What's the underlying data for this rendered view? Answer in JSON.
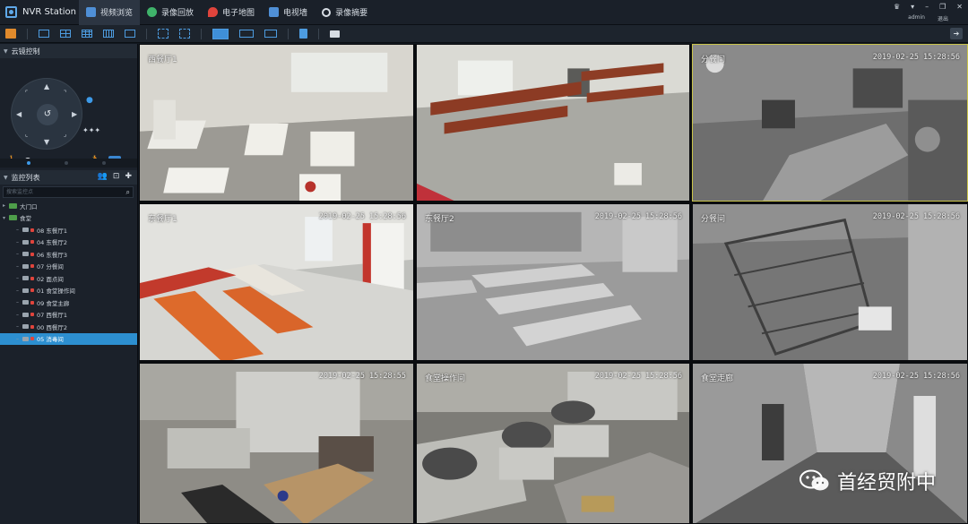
{
  "app": {
    "name": "NVR Station",
    "user": "admin",
    "logout": "退出"
  },
  "tabs": [
    {
      "label": "视频浏览",
      "active": true,
      "icon": "monitor-icon",
      "color": "#4f8fd6"
    },
    {
      "label": "录像回放",
      "active": false,
      "icon": "playback-icon",
      "color": "#3fb36a"
    },
    {
      "label": "电子地图",
      "active": false,
      "icon": "map-pin-icon",
      "color": "#e0443c"
    },
    {
      "label": "电视墙",
      "active": false,
      "icon": "tv-wall-icon",
      "color": "#4f8fd6"
    },
    {
      "label": "录像摘要",
      "active": false,
      "icon": "search-icon",
      "color": "#d8dee5"
    }
  ],
  "ptz": {
    "title": "云镜控制"
  },
  "device_tree": {
    "title": "监控列表",
    "search_placeholder": "搜索监控点",
    "nodes": [
      {
        "label": "大门口",
        "level": 0,
        "type": "group",
        "expanded": false
      },
      {
        "label": "食堂",
        "level": 0,
        "type": "group",
        "expanded": true
      },
      {
        "label": "08 东餐厅1",
        "level": 1,
        "type": "camera"
      },
      {
        "label": "04 东餐厅2",
        "level": 1,
        "type": "camera"
      },
      {
        "label": "06 东餐厅3",
        "level": 1,
        "type": "camera"
      },
      {
        "label": "07 分餐间",
        "level": 1,
        "type": "camera"
      },
      {
        "label": "02 面点间",
        "level": 1,
        "type": "camera"
      },
      {
        "label": "01 食堂操作间",
        "level": 1,
        "type": "camera"
      },
      {
        "label": "09 食堂主廊",
        "level": 1,
        "type": "camera"
      },
      {
        "label": "07 西餐厅1",
        "level": 1,
        "type": "camera"
      },
      {
        "label": "00 西餐厅2",
        "level": 1,
        "type": "camera"
      },
      {
        "label": "05 消毒间",
        "level": 1,
        "type": "camera",
        "selected": true
      }
    ]
  },
  "tiles": [
    {
      "name": "西餐厅1",
      "timestamp": "",
      "scene": "color-dining-left"
    },
    {
      "name": "",
      "timestamp": "",
      "scene": "color-dining-right"
    },
    {
      "name": "分餐间",
      "timestamp": "2019-02-25 15:28:56",
      "scene": "ir-kitchen",
      "focused": true
    },
    {
      "name": "东餐厅1",
      "timestamp": "2019-02-25 15:28:56",
      "scene": "color-orange-hall"
    },
    {
      "name": "东餐厅2",
      "timestamp": "2019-02-25 15:28:56",
      "scene": "gray-hall"
    },
    {
      "name": "分餐间",
      "timestamp": "2019-02-25 15:28:56",
      "scene": "ir-shelves"
    },
    {
      "name": "",
      "timestamp": "2019-02-25 15:28:55",
      "scene": "color-kitchen-left"
    },
    {
      "name": "食堂操作间",
      "timestamp": "2019-02-25 15:28:56",
      "scene": "color-kitchen-woks"
    },
    {
      "name": "食堂走廊",
      "timestamp": "2019-02-25 15:28:56",
      "scene": "ir-corridor"
    }
  ],
  "watermark": {
    "text": "首经贸附中",
    "icon": "wechat-icon"
  },
  "colors": {
    "accent": "#2d8fd0",
    "focus_border": "#c9c34a"
  }
}
